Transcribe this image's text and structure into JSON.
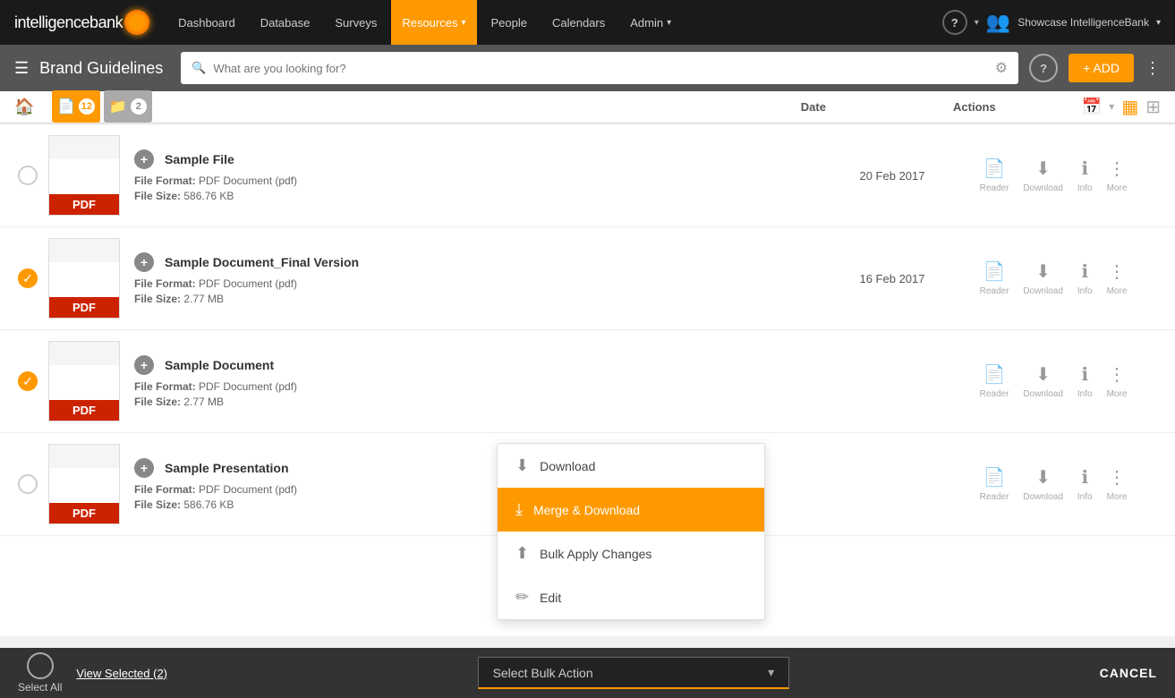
{
  "app": {
    "logo_text": "intelligencebank",
    "title": "Showcase IntelligenceBank"
  },
  "top_nav": {
    "items": [
      {
        "label": "Dashboard",
        "active": false
      },
      {
        "label": "Database",
        "active": false
      },
      {
        "label": "Surveys",
        "active": false
      },
      {
        "label": "Resources",
        "active": true,
        "has_chevron": true
      },
      {
        "label": "People",
        "active": false
      },
      {
        "label": "Calendars",
        "active": false
      },
      {
        "label": "Admin",
        "active": false,
        "has_chevron": true
      }
    ]
  },
  "second_bar": {
    "title": "Brand Guidelines",
    "search_placeholder": "What are you looking for?",
    "add_label": "+ ADD"
  },
  "file_tabs": {
    "files_count": 12,
    "folders_count": 2
  },
  "list_header": {
    "date_label": "Date",
    "actions_label": "Actions"
  },
  "files": [
    {
      "id": 1,
      "checked": false,
      "name": "Sample File",
      "format": "PDF Document (pdf)",
      "size": "586.76 KB",
      "date": "20 Feb 2017",
      "actions": [
        "Reader",
        "Download",
        "Info",
        "More"
      ]
    },
    {
      "id": 2,
      "checked": true,
      "name": "Sample Document_Final Version",
      "format": "PDF Document (pdf)",
      "size": "2.77 MB",
      "date": "16 Feb 2017",
      "actions": [
        "Reader",
        "Download",
        "Info",
        "More"
      ]
    },
    {
      "id": 3,
      "checked": true,
      "name": "Sample Document",
      "format": "PDF Document (pdf)",
      "size": "2.77 MB",
      "date": "",
      "actions": [
        "Reader",
        "Download",
        "Info",
        "More"
      ]
    },
    {
      "id": 4,
      "checked": false,
      "name": "Sample Presentation",
      "format": "PDF Document (pdf)",
      "size": "586.76 KB",
      "date": "",
      "actions": [
        "Reader",
        "Download",
        "Info",
        "More"
      ]
    }
  ],
  "dropdown_menu": {
    "items": [
      {
        "label": "Download",
        "icon": "download",
        "active": false
      },
      {
        "label": "Merge & Download",
        "icon": "merge",
        "active": true
      },
      {
        "label": "Bulk Apply Changes",
        "icon": "upload",
        "active": false
      },
      {
        "label": "Edit",
        "icon": "edit",
        "active": false
      }
    ]
  },
  "bottom_bar": {
    "select_all_label": "Select All",
    "view_selected_label": "View Selected (2)",
    "bulk_action_placeholder": "Select Bulk Action",
    "cancel_label": "CANCEL"
  }
}
